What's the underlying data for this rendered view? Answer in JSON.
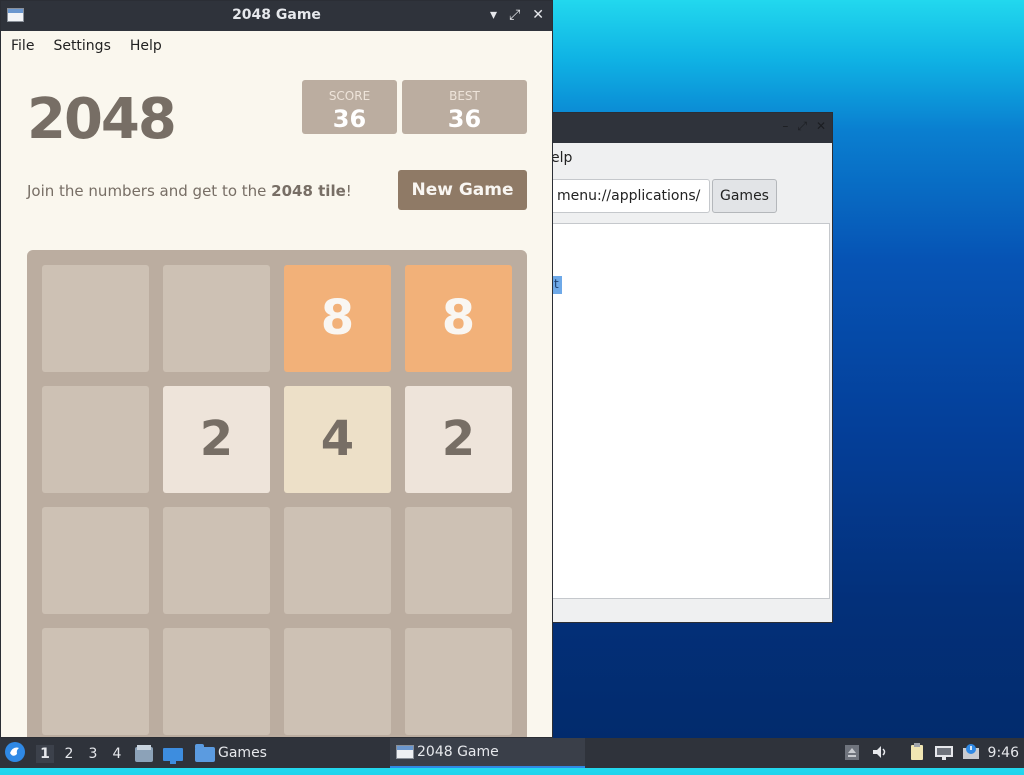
{
  "background_window": {
    "menu_fragment": "elp",
    "path_value": "menu://applications/",
    "games_button": "Games",
    "selected_fragment": "t"
  },
  "window": {
    "title": "2048 Game",
    "minimize": "▾",
    "maximize": "⤢",
    "close": "✕"
  },
  "menu": {
    "file": "File",
    "settings": "Settings",
    "help": "Help"
  },
  "game": {
    "logo": "2048",
    "score_label": "SCORE",
    "score": "36",
    "best_label": "BEST",
    "best": "36",
    "intro_prefix": "Join the numbers and get to the ",
    "intro_bold": "2048 tile",
    "intro_suffix": "!",
    "new_game": "New Game",
    "grid": [
      [
        0,
        0,
        8,
        8
      ],
      [
        0,
        2,
        4,
        2
      ],
      [
        0,
        0,
        0,
        0
      ],
      [
        0,
        0,
        0,
        0
      ]
    ]
  },
  "taskbar": {
    "workspaces": [
      "1",
      "2",
      "3",
      "4"
    ],
    "active_workspace": "1",
    "games_folder": "Games",
    "active_window": "2048 Game",
    "clock": "9:46"
  },
  "colors": {
    "tile_8": "#f2b179",
    "tile_4": "#ede0c8",
    "tile_2": "#eee4da",
    "empty": "#cdc1b4",
    "board": "#bbada0"
  }
}
